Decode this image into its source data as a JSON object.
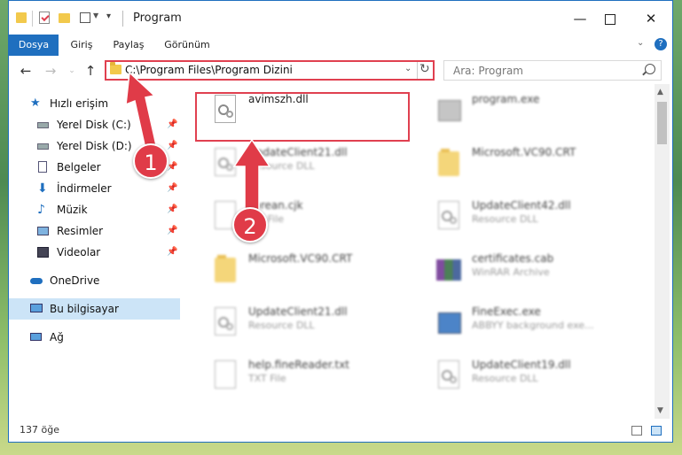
{
  "window": {
    "title": "Program",
    "controls": [
      "minimize-icon",
      "maximize-icon",
      "close-icon"
    ]
  },
  "ribbon": {
    "tabs": [
      {
        "label": "Dosya",
        "active": true
      },
      {
        "label": "Giriş",
        "active": false
      },
      {
        "label": "Paylaş",
        "active": false
      },
      {
        "label": "Görünüm",
        "active": false
      }
    ]
  },
  "address": {
    "path": "C:\\Program Files\\Program Dizini"
  },
  "search": {
    "placeholder": "Ara: Program"
  },
  "sidebar": {
    "items": [
      {
        "label": "Hızlı erişim",
        "icon": "star-icon",
        "pinned": false
      },
      {
        "label": "Yerel Disk (C:)",
        "icon": "drive-icon",
        "pinned": true
      },
      {
        "label": "Yerel Disk (D:)",
        "icon": "drive-icon",
        "pinned": true
      },
      {
        "label": "Belgeler",
        "icon": "documents-icon",
        "pinned": true
      },
      {
        "label": "İndirmeler",
        "icon": "download-icon",
        "pinned": true
      },
      {
        "label": "Müzik",
        "icon": "music-icon",
        "pinned": true
      },
      {
        "label": "Resimler",
        "icon": "pictures-icon",
        "pinned": true
      },
      {
        "label": "Videolar",
        "icon": "videos-icon",
        "pinned": true
      },
      {
        "label": "OneDrive",
        "icon": "cloud-icon",
        "pinned": false
      },
      {
        "label": "Bu bilgisayar",
        "icon": "computer-icon",
        "pinned": false,
        "selected": true
      },
      {
        "label": "Ağ",
        "icon": "network-icon",
        "pinned": false
      }
    ]
  },
  "files": [
    {
      "name": "avimszh.dll",
      "sub": "",
      "type": "dll",
      "highlight": true
    },
    {
      "name": "program.exe",
      "sub": "",
      "type": "exe"
    },
    {
      "name": "UpdateClient21.dll",
      "sub": "Resource DLL",
      "type": "dll"
    },
    {
      "name": "Microsoft.VC90.CRT",
      "sub": "",
      "type": "folder"
    },
    {
      "name": "korean.cjk",
      "sub": "CJK File",
      "type": "file"
    },
    {
      "name": "UpdateClient42.dll",
      "sub": "Resource DLL",
      "type": "dll"
    },
    {
      "name": "Microsoft.VC90.CRT",
      "sub": "",
      "type": "folder"
    },
    {
      "name": "certificates.cab",
      "sub": "WinRAR Archive",
      "type": "archive"
    },
    {
      "name": "UpdateClient21.dll",
      "sub": "Resource DLL",
      "type": "dll"
    },
    {
      "name": "FineExec.exe",
      "sub": "ABBYY background exe...",
      "type": "app"
    },
    {
      "name": "help.fineReader.txt",
      "sub": "TXT File",
      "type": "file"
    },
    {
      "name": "UpdateClient19.dll",
      "sub": "Resource DLL",
      "type": "dll"
    }
  ],
  "status": {
    "count": "137 öğe"
  },
  "callouts": [
    "1",
    "2"
  ],
  "colors": {
    "accent": "#1f6fbf",
    "callout": "#e03b48",
    "highlight_border": "#e04050",
    "selection": "#cce4f7"
  }
}
